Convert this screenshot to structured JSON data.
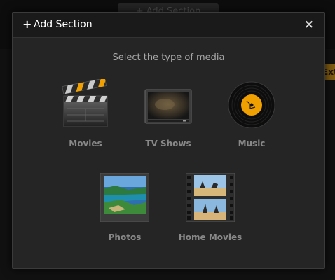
{
  "background": {
    "tab_label": "+ Add Section",
    "tag_label": "Ext"
  },
  "modal": {
    "title": "Add Section",
    "plus_icon": "+",
    "close_icon": "×",
    "prompt": "Select the type of media",
    "media_types": [
      {
        "label": "Movies",
        "icon": "clapperboard-icon"
      },
      {
        "label": "TV Shows",
        "icon": "tv-icon"
      },
      {
        "label": "Music",
        "icon": "vinyl-record-icon"
      },
      {
        "label": "Photos",
        "icon": "photo-icon"
      },
      {
        "label": "Home Movies",
        "icon": "film-strip-icon"
      }
    ]
  },
  "colors": {
    "accent": "#f0a000",
    "modal_bg": "#252525",
    "header_bg": "#1a1a1a",
    "label": "#888888"
  }
}
